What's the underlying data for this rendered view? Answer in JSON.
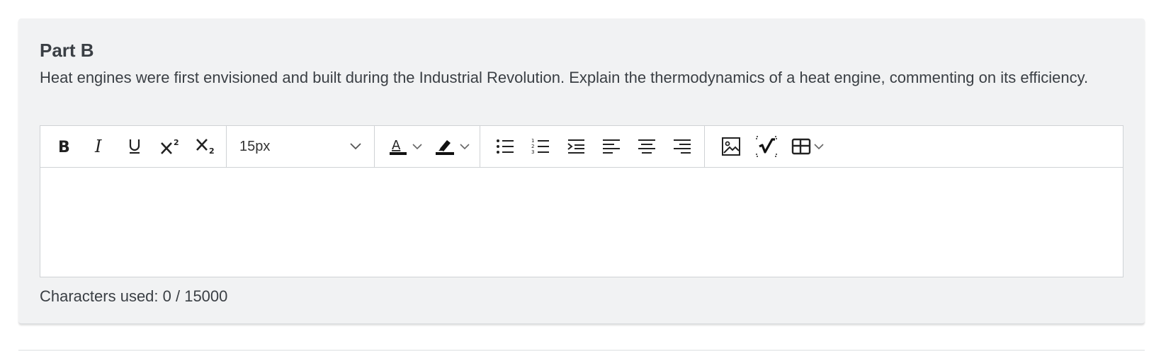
{
  "question": {
    "part_title": "Part B",
    "prompt": "Heat engines were first envisioned and built during the Industrial Revolution. Explain the thermodynamics of a heat engine, commenting on its efficiency."
  },
  "editor": {
    "toolbar": {
      "font_size": {
        "selected": "15px"
      },
      "buttons": [
        {
          "icon": "bold-icon"
        },
        {
          "icon": "italic-icon"
        },
        {
          "icon": "underline-icon"
        },
        {
          "icon": "superscript-icon"
        },
        {
          "icon": "subscript-icon"
        },
        {
          "icon": "font-color-icon"
        },
        {
          "icon": "highlight-icon"
        },
        {
          "icon": "bulleted-list-icon"
        },
        {
          "icon": "numbered-list-icon"
        },
        {
          "icon": "outdent-icon"
        },
        {
          "icon": "align-left-icon"
        },
        {
          "icon": "align-center-icon"
        },
        {
          "icon": "align-right-icon"
        },
        {
          "icon": "image-icon"
        },
        {
          "icon": "math-icon"
        },
        {
          "icon": "table-icon"
        }
      ]
    },
    "content": ""
  },
  "counter": {
    "text": "Characters used: 0 / 15000"
  },
  "colors": {
    "card_bg": "#f1f2f3",
    "text": "#3a3f44",
    "border": "#cfd2d5"
  }
}
